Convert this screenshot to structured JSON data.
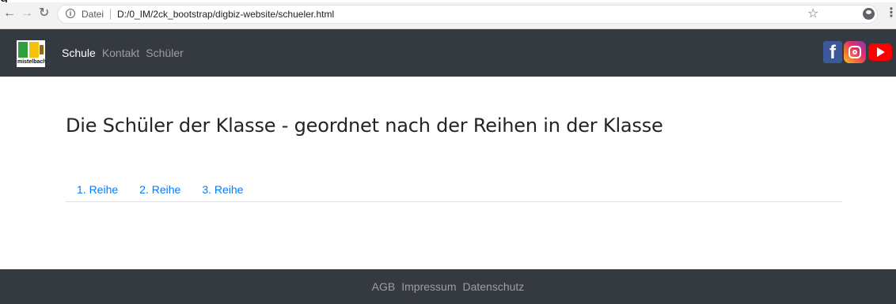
{
  "browser": {
    "scheme_label": "Datei",
    "url": "D:/0_IM/2ck_bootstrap/digbiz-website/schueler.html",
    "top_fragment": "g"
  },
  "logo": {
    "text": "mistelbach",
    "colors": [
      "#2e9e3e",
      "#f4c20d",
      "#8a6d1c"
    ]
  },
  "nav": {
    "items": [
      {
        "label": "Schule",
        "active": true
      },
      {
        "label": "Kontakt",
        "active": false
      },
      {
        "label": "Schüler",
        "active": false
      }
    ]
  },
  "social": {
    "icons": [
      "facebook-icon",
      "instagram-icon",
      "youtube-icon"
    ],
    "facebook_glyph": "f"
  },
  "main": {
    "title": "Die Schüler der Klasse - geordnet nach der Reihen in der Klasse",
    "tabs": [
      {
        "label": "1. Reihe"
      },
      {
        "label": "2. Reihe"
      },
      {
        "label": "3. Reihe"
      }
    ]
  },
  "footer": {
    "links": [
      {
        "label": "AGB"
      },
      {
        "label": "Impressum"
      },
      {
        "label": "Datenschutz"
      }
    ]
  },
  "colors": {
    "navbar_bg": "#343a40",
    "link_blue": "#007bff",
    "title_text": "#212529"
  }
}
